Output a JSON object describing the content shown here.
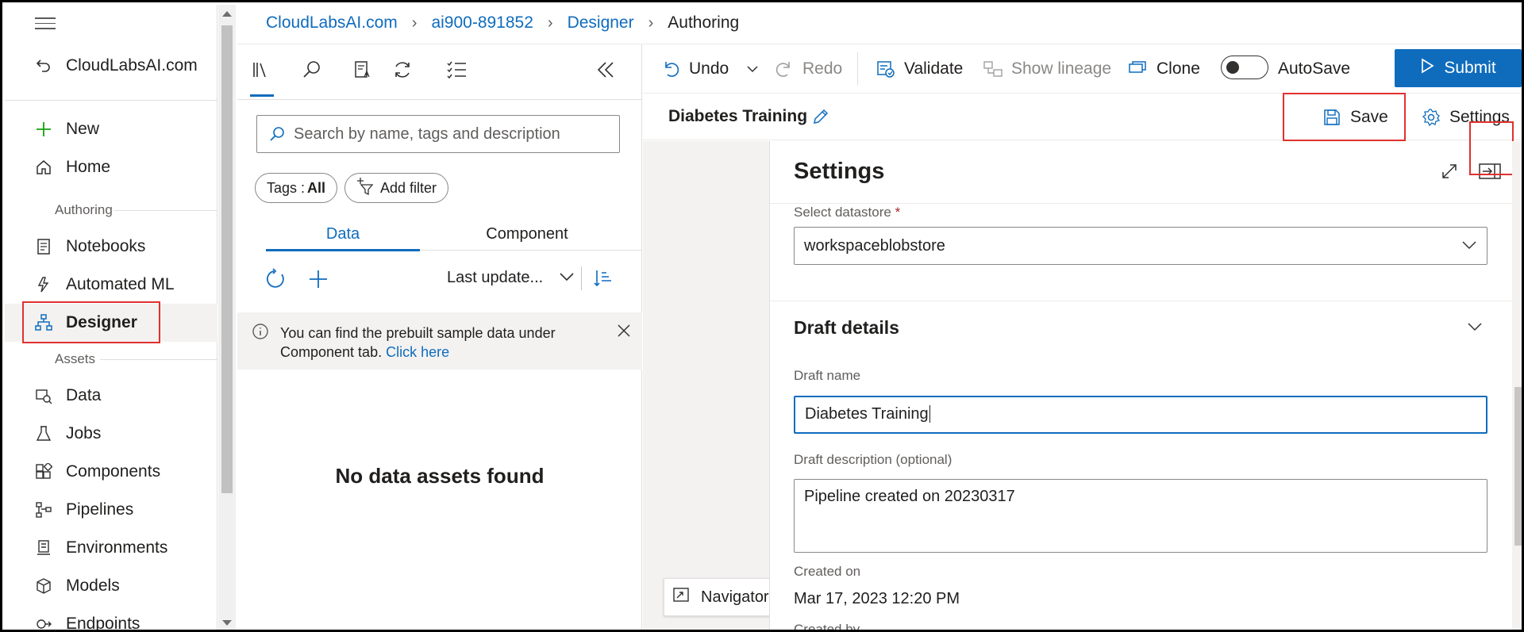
{
  "breadcrumb": {
    "items": [
      "CloudLabsAI.com",
      "ai900-891852",
      "Designer"
    ],
    "current": "Authoring"
  },
  "leftnav": {
    "back_label": "CloudLabsAI.com",
    "new_label": "New",
    "home_label": "Home",
    "authoring_section": "Authoring",
    "notebooks_label": "Notebooks",
    "automl_label": "Automated ML",
    "designer_label": "Designer",
    "assets_section": "Assets",
    "data_label": "Data",
    "jobs_label": "Jobs",
    "components_label": "Components",
    "pipelines_label": "Pipelines",
    "environments_label": "Environments",
    "models_label": "Models",
    "endpoints_label": "Endpoints"
  },
  "library": {
    "search_placeholder": "Search by name, tags and description",
    "tags_prefix": "Tags : ",
    "tags_value": "All",
    "add_filter_label": "Add filter",
    "tab_data": "Data",
    "tab_component": "Component",
    "sort_label": "Last update...",
    "info_text": "You can find the prebuilt sample data under Component tab.",
    "info_link": "Click here",
    "empty_message": "No data assets found"
  },
  "toolbar": {
    "undo": "Undo",
    "redo": "Redo",
    "validate": "Validate",
    "show_lineage": "Show lineage",
    "clone": "Clone",
    "autosave": "AutoSave",
    "autosave_on": false,
    "submit": "Submit"
  },
  "subheader": {
    "pipeline_name": "Diabetes Training",
    "save": "Save",
    "settings": "Settings"
  },
  "canvas": {
    "navigator_label": "Navigator"
  },
  "settings": {
    "title": "Settings",
    "datastore_label": "Select datastore",
    "datastore_required": "*",
    "datastore_value": "workspaceblobstore",
    "draft_section": "Draft details",
    "draft_name_label": "Draft name",
    "draft_name_value": "Diabetes Training",
    "draft_desc_label": "Draft description (optional)",
    "draft_desc_value": "Pipeline created on 20230317",
    "created_on_label": "Created on",
    "created_on_value": "Mar 17, 2023 12:20 PM",
    "created_by_label": "Created by"
  },
  "colors": {
    "accent": "#0f6cbd",
    "highlight": "#e0312f",
    "add": "#13a10e"
  }
}
